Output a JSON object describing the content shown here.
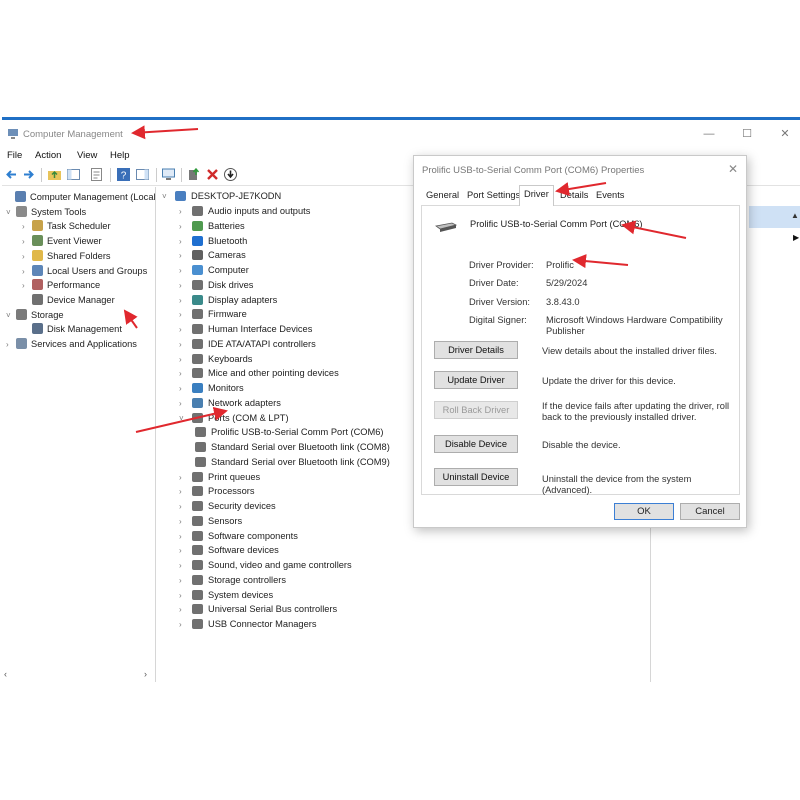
{
  "window": {
    "title": "Computer Management",
    "controls": {
      "minimize": "—",
      "maximize": "☐",
      "close": "✕"
    }
  },
  "menu": [
    "File",
    "Action",
    "View",
    "Help"
  ],
  "left_tree": [
    {
      "label": "Computer Management (Local",
      "chev": "",
      "icon": "computer-management-icon",
      "color": "#5a7fb0"
    },
    {
      "label": "System Tools",
      "chev": "v",
      "icon": "tools-icon",
      "color": "#8a8a8a"
    },
    {
      "label": "Task Scheduler",
      "chev": ">",
      "icon": "clock-icon",
      "color": "#c7a24a"
    },
    {
      "label": "Event Viewer",
      "chev": ">",
      "icon": "event-viewer-icon",
      "color": "#6a8f5a"
    },
    {
      "label": "Shared Folders",
      "chev": ">",
      "icon": "shared-folder-icon",
      "color": "#e0b84a"
    },
    {
      "label": "Local Users and Groups",
      "chev": ">",
      "icon": "users-icon",
      "color": "#5d86b8"
    },
    {
      "label": "Performance",
      "chev": ">",
      "icon": "performance-icon",
      "color": "#b06060"
    },
    {
      "label": "Device Manager",
      "chev": "",
      "icon": "device-manager-icon",
      "color": "#707070"
    },
    {
      "label": "Storage",
      "chev": "v",
      "icon": "storage-icon",
      "color": "#7a7a7a"
    },
    {
      "label": "Disk Management",
      "chev": "",
      "icon": "disk-management-icon",
      "color": "#5a6f8a"
    },
    {
      "label": "Services and Applications",
      "chev": ">",
      "icon": "services-icon",
      "color": "#7a8fa8"
    }
  ],
  "device_tree": {
    "root": "DESKTOP-JE7KODN",
    "items": [
      {
        "label": "Audio inputs and outputs",
        "chev": ">",
        "icon": "audio-icon",
        "color": "#707070"
      },
      {
        "label": "Batteries",
        "chev": ">",
        "icon": "battery-icon",
        "color": "#4f9a4f"
      },
      {
        "label": "Bluetooth",
        "chev": ">",
        "icon": "bluetooth-icon",
        "color": "#1f6fd0"
      },
      {
        "label": "Cameras",
        "chev": ">",
        "icon": "camera-icon",
        "color": "#606060"
      },
      {
        "label": "Computer",
        "chev": ">",
        "icon": "computer-icon",
        "color": "#4a8fd0"
      },
      {
        "label": "Disk drives",
        "chev": ">",
        "icon": "disk-drive-icon",
        "color": "#707070"
      },
      {
        "label": "Display adapters",
        "chev": ">",
        "icon": "display-adapter-icon",
        "color": "#3a8a8a"
      },
      {
        "label": "Firmware",
        "chev": ">",
        "icon": "firmware-icon",
        "color": "#707070"
      },
      {
        "label": "Human Interface Devices",
        "chev": ">",
        "icon": "hid-icon",
        "color": "#707070"
      },
      {
        "label": "IDE ATA/ATAPI controllers",
        "chev": ">",
        "icon": "ide-icon",
        "color": "#707070"
      },
      {
        "label": "Keyboards",
        "chev": ">",
        "icon": "keyboard-icon",
        "color": "#707070"
      },
      {
        "label": "Mice and other pointing devices",
        "chev": ">",
        "icon": "mouse-icon",
        "color": "#707070"
      },
      {
        "label": "Monitors",
        "chev": ">",
        "icon": "monitor-icon",
        "color": "#3a7fc0"
      },
      {
        "label": "Network adapters",
        "chev": ">",
        "icon": "network-adapter-icon",
        "color": "#4a7fb0"
      },
      {
        "label": "Ports (COM & LPT)",
        "chev": "v",
        "icon": "port-icon",
        "color": "#707070"
      },
      {
        "label": "Prolific USB-to-Serial Comm Port (COM6)",
        "chev": "",
        "icon": "port-icon",
        "color": "#707070",
        "child": true
      },
      {
        "label": "Standard Serial over Bluetooth link (COM8)",
        "chev": "",
        "icon": "port-icon",
        "color": "#707070",
        "child": true
      },
      {
        "label": "Standard Serial over Bluetooth link (COM9)",
        "chev": "",
        "icon": "port-icon",
        "color": "#707070",
        "child": true
      },
      {
        "label": "Print queues",
        "chev": ">",
        "icon": "printer-icon",
        "color": "#707070"
      },
      {
        "label": "Processors",
        "chev": ">",
        "icon": "processor-icon",
        "color": "#707070"
      },
      {
        "label": "Security devices",
        "chev": ">",
        "icon": "security-device-icon",
        "color": "#707070"
      },
      {
        "label": "Sensors",
        "chev": ">",
        "icon": "sensor-icon",
        "color": "#707070"
      },
      {
        "label": "Software components",
        "chev": ">",
        "icon": "software-component-icon",
        "color": "#707070"
      },
      {
        "label": "Software devices",
        "chev": ">",
        "icon": "software-device-icon",
        "color": "#707070"
      },
      {
        "label": "Sound, video and game controllers",
        "chev": ">",
        "icon": "sound-icon",
        "color": "#707070"
      },
      {
        "label": "Storage controllers",
        "chev": ">",
        "icon": "storage-controller-icon",
        "color": "#707070"
      },
      {
        "label": "System devices",
        "chev": ">",
        "icon": "system-device-icon",
        "color": "#707070"
      },
      {
        "label": "Universal Serial Bus controllers",
        "chev": ">",
        "icon": "usb-icon",
        "color": "#707070"
      },
      {
        "label": "USB Connector Managers",
        "chev": ">",
        "icon": "usb-connector-icon",
        "color": "#707070"
      }
    ]
  },
  "dialog": {
    "title": "Prolific USB-to-Serial Comm Port (COM6) Properties",
    "close": "✕",
    "tabs": [
      "General",
      "Port Settings",
      "Driver",
      "Details",
      "Events"
    ],
    "active_tab": "Driver",
    "device_name": "Prolific USB-to-Serial Comm Port (COM6)",
    "fields": [
      {
        "label": "Driver Provider:",
        "value": "Prolific"
      },
      {
        "label": "Driver Date:",
        "value": "5/29/2024"
      },
      {
        "label": "Driver Version:",
        "value": "3.8.43.0"
      },
      {
        "label": "Digital Signer:",
        "value": "Microsoft Windows Hardware Compatibility Publisher"
      }
    ],
    "actions": [
      {
        "button": "Driver Details",
        "desc": "View details about the installed driver files.",
        "disabled": false
      },
      {
        "button": "Update Driver",
        "desc": "Update the driver for this device.",
        "disabled": false
      },
      {
        "button": "Roll Back Driver",
        "desc": "If the device fails after updating the driver, roll back to the previously installed driver.",
        "disabled": true
      },
      {
        "button": "Disable Device",
        "desc": "Disable the device.",
        "disabled": false
      },
      {
        "button": "Uninstall Device",
        "desc": "Uninstall the device from the system (Advanced).",
        "disabled": false
      }
    ],
    "ok": "OK",
    "cancel": "Cancel"
  },
  "colors": {
    "accent": "#1f6fc5",
    "annotation_arrow": "#e0282e",
    "selection": "#cfe1f5"
  }
}
